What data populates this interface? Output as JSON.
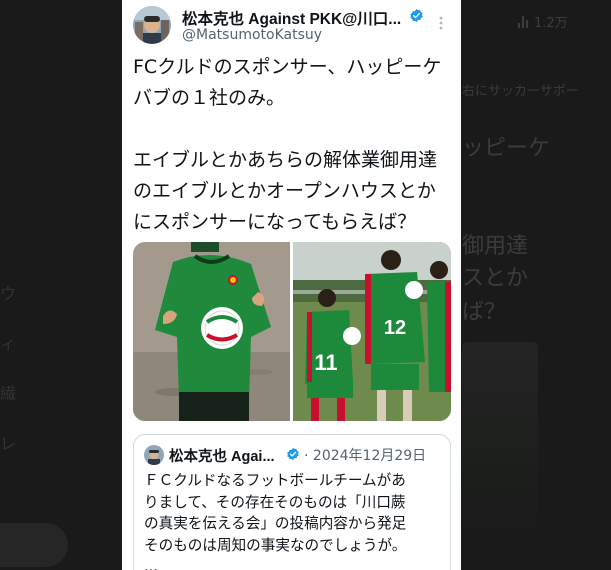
{
  "background": {
    "stat_count": "1.2万",
    "fragment_top": "右にサッカーサポー",
    "fragment_line1": "ッピーケ",
    "fragment_line2": "御用達",
    "fragment_line3": "スとか",
    "fragment_line4": "ば？",
    "side_chars": [
      "ウ",
      "ィ",
      "繊",
      "レ"
    ]
  },
  "tweet": {
    "author": {
      "display_name": "松本克也 Against PKK@川口...",
      "handle": "@MatsumotoKatsuy",
      "verified": true
    },
    "text_lines": [
      "FCクルドのスポンサー、ハッピーケ",
      "バブの１社のみ。",
      "",
      "エイブルとかあちらの解体業御用達",
      "のエイブルとかオープンハウスとか",
      "にスポンサーになってもらえば？"
    ],
    "media": [
      {
        "icon": "photo-player-with-sponsor-badge"
      },
      {
        "icon": "photo-players-numbers-11-12",
        "jersey_numbers": [
          "11",
          "12"
        ]
      }
    ]
  },
  "quoted_tweet": {
    "display_name": "松本克也 Agai...",
    "separator": "·",
    "date": "2024年12月29日",
    "text_lines": [
      "ＦＣクルドなるフットボールチームがあ",
      "りまして、その存在そのものは「川口蕨",
      "の真実を伝える会」の投稿内容から発足",
      "そのものは周知の事実なのでしょうが。",
      "..."
    ]
  },
  "colors": {
    "verified_blue": "#1d9bf0",
    "text_primary": "#0f1419",
    "text_secondary": "#536471",
    "border": "#cfd9de"
  }
}
